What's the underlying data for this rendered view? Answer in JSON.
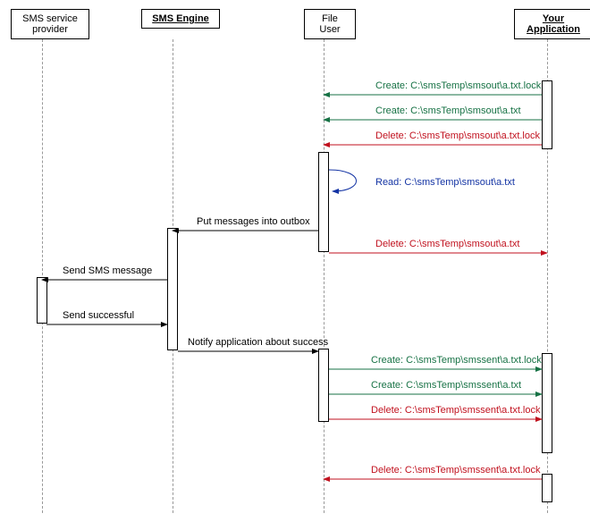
{
  "participants": {
    "sms_provider": "SMS service\nprovider",
    "sms_engine": "SMS Engine",
    "file_user": "File\nUser",
    "your_app": "Your\nApplication"
  },
  "messages": {
    "m1": "Create: C:\\smsTemp\\smsout\\a.txt.lock",
    "m2": "Create: C:\\smsTemp\\smsout\\a.txt",
    "m3": "Delete: C:\\smsTemp\\smsout\\a.txt.lock",
    "m4": "Read: C:\\smsTemp\\smsout\\a.txt",
    "m5": "Put messages into outbox",
    "m6": "Delete: C:\\smsTemp\\smsout\\a.txt",
    "m7": "Send SMS message",
    "m8": "Send successful",
    "m9": "Notify application about success",
    "m10": "Create: C:\\smsTemp\\smssent\\a.txt.lock",
    "m11": "Create: C:\\smsTemp\\smssent\\a.txt",
    "m12": "Delete: C:\\smsTemp\\smssent\\a.txt.lock",
    "m13": "Delete: C:\\smsTemp\\smssent\\a.txt.lock"
  }
}
